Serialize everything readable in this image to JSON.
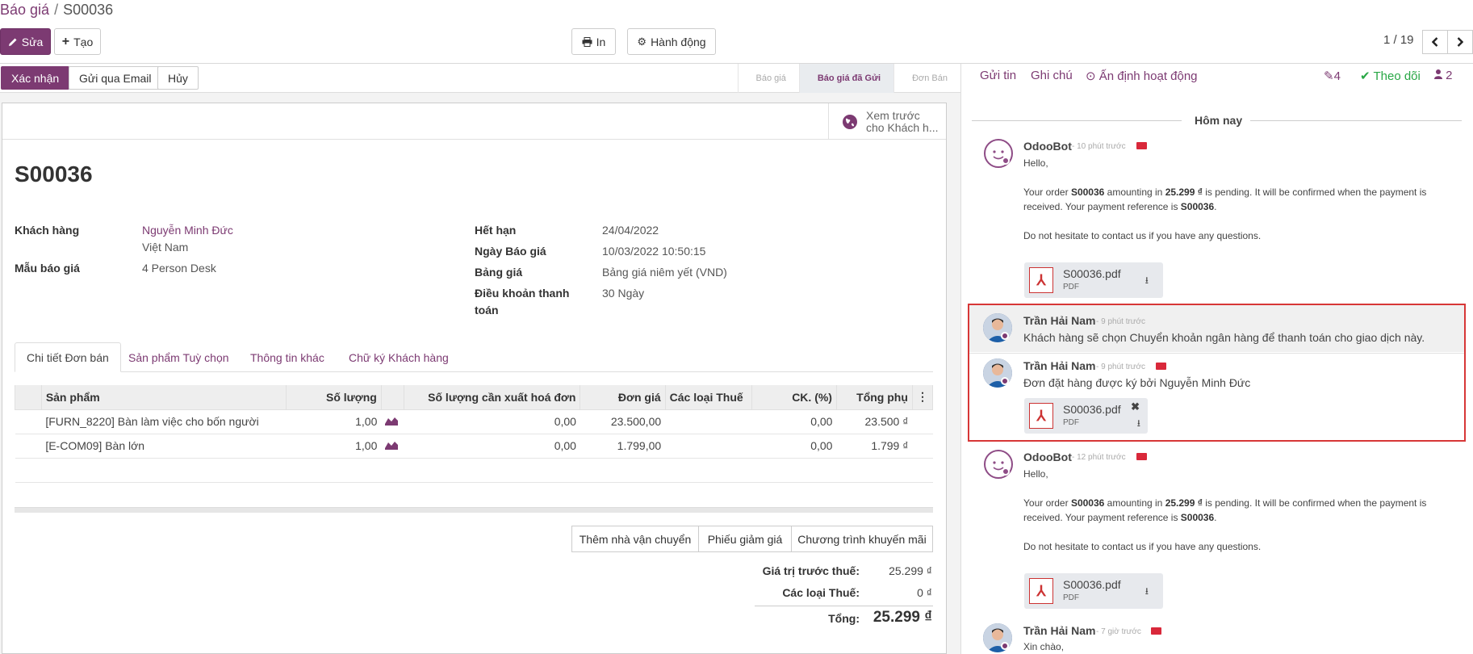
{
  "breadcrumb": {
    "parent": "Báo giá",
    "separator": "/",
    "current": "S00036"
  },
  "toolbar": {
    "edit": "Sửa",
    "create": "Tạo",
    "print": "In",
    "action": "Hành động"
  },
  "pager": {
    "value": "1 / 19"
  },
  "statusbar": {
    "buttons": [
      "Xác nhận",
      "Gửi qua Email",
      "Hủy"
    ],
    "stages": [
      "Báo giá",
      "Báo giá đã Gửi",
      "Đơn Bán"
    ]
  },
  "smart_button": {
    "line1": "Xem trước",
    "line2": "cho Khách h..."
  },
  "form": {
    "name": "S00036",
    "customer_label": "Khách hàng",
    "customer_name": "Nguyễn Minh Đức",
    "customer_country": "Việt Nam",
    "template_label": "Mẫu báo giá",
    "template_value": "4 Person Desk",
    "expiry_label": "Hết hạn",
    "expiry_value": "24/04/2022",
    "date_label": "Ngày Báo giá",
    "date_value": "10/03/2022 10:50:15",
    "pricelist_label": "Bảng giá",
    "pricelist_value": "Bảng giá niêm yết (VND)",
    "terms_label_1": "Điều khoản thanh",
    "terms_label_2": "toán",
    "terms_value": "30 Ngày"
  },
  "tabs": [
    "Chi tiết Đơn bán",
    "Sản phẩm Tuỳ chọn",
    "Thông tin khác",
    "Chữ ký Khách hàng"
  ],
  "lines": {
    "headers": [
      "Sản phẩm",
      "Số lượng",
      "Số lượng cần xuất hoá đơn",
      "Đơn giá",
      "Các loại Thuế",
      "CK. (%)",
      "Tổng phụ"
    ],
    "rows": [
      {
        "product": "[FURN_8220] Bàn làm việc cho bốn người",
        "qty": "1,00",
        "to_invoice": "0,00",
        "price": "23.500,00",
        "taxes": "",
        "discount": "0,00",
        "subtotal": "23.500 ₫"
      },
      {
        "product": "[E-COM09] Bàn lớn",
        "qty": "1,00",
        "to_invoice": "0,00",
        "price": "1.799,00",
        "taxes": "",
        "discount": "0,00",
        "subtotal": "1.799 ₫"
      }
    ]
  },
  "order_buttons": [
    "Thêm nhà vận chuyển",
    "Phiếu giảm giá",
    "Chương trình khuyến mãi"
  ],
  "totals": {
    "untaxed_label": "Giá trị trước thuế:",
    "untaxed_value": "25.299 ₫",
    "tax_label": "Các loại Thuế:",
    "tax_value": "0 ₫",
    "total_label": "Tổng:",
    "total_value": "25.299 ₫"
  },
  "chatter": {
    "send": "Gửi tin",
    "note": "Ghi chú",
    "activity": "Ấn định hoạt động",
    "attach_count": "4",
    "follow": "Theo dõi",
    "followers": "2",
    "today": "Hôm nay",
    "messages": [
      {
        "author": "OdooBot",
        "date": "- 10 phút trước",
        "line1": "Hello,",
        "line2_a": "Your order ",
        "line2_b": "S00036",
        "line2_c": " amounting in ",
        "line2_d": "25.299 ₫",
        "line2_e": " is pending. It will be confirmed when the payment is",
        "line3_a": "received. Your payment reference is ",
        "line3_b": "S00036",
        "line3_c": ".",
        "line4": "Do not hesitate to contact us if you have any questions.",
        "attachment": "S00036.pdf",
        "ext": "PDF"
      },
      {
        "author": "Trần Hải Nam",
        "date": "- 9 phút trước",
        "body": "Khách hàng sẽ chọn Chuyển khoản ngân hàng để thanh toán cho giao dịch này."
      },
      {
        "author": "Trần Hải Nam",
        "date": "- 9 phút trước",
        "body": "Đơn đặt hàng được ký bởi Nguyễn Minh Đức",
        "attachment": "S00036.pdf",
        "ext": "PDF"
      },
      {
        "author": "OdooBot",
        "date": "- 12 phút trước",
        "line1": "Hello,",
        "line2_a": "Your order ",
        "line2_b": "S00036",
        "line2_c": " amounting in ",
        "line2_d": "25.299 ₫",
        "line2_e": " is pending. It will be confirmed when the payment is",
        "line3_a": "received. Your payment reference is ",
        "line3_b": "S00036",
        "line3_c": ".",
        "line4": "Do not hesitate to contact us if you have any questions.",
        "attachment": "S00036.pdf",
        "ext": "PDF"
      },
      {
        "author": "Trần Hải Nam",
        "date": "- 7 giờ trước",
        "body": "Xin chào,"
      }
    ]
  }
}
